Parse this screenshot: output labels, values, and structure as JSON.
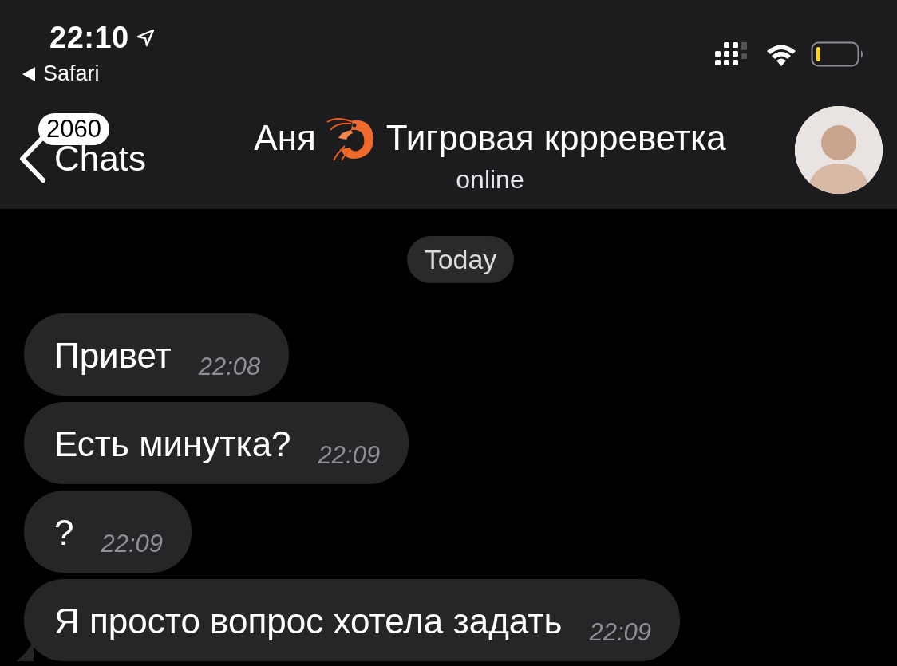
{
  "status_bar": {
    "time": "22:10",
    "back_app": "Safari"
  },
  "header": {
    "back_label": "Chats",
    "unread_count": "2060",
    "name": "Аня",
    "title_rest": "Тигровая кррреветка",
    "status": "online"
  },
  "date_label": "Today",
  "messages": [
    {
      "text": "Привет",
      "time": "22:08"
    },
    {
      "text": "Есть минутка?",
      "time": "22:09"
    },
    {
      "text": "?",
      "time": "22:09"
    },
    {
      "text": "Я просто вопрос хотела задать",
      "time": "22:09"
    }
  ]
}
